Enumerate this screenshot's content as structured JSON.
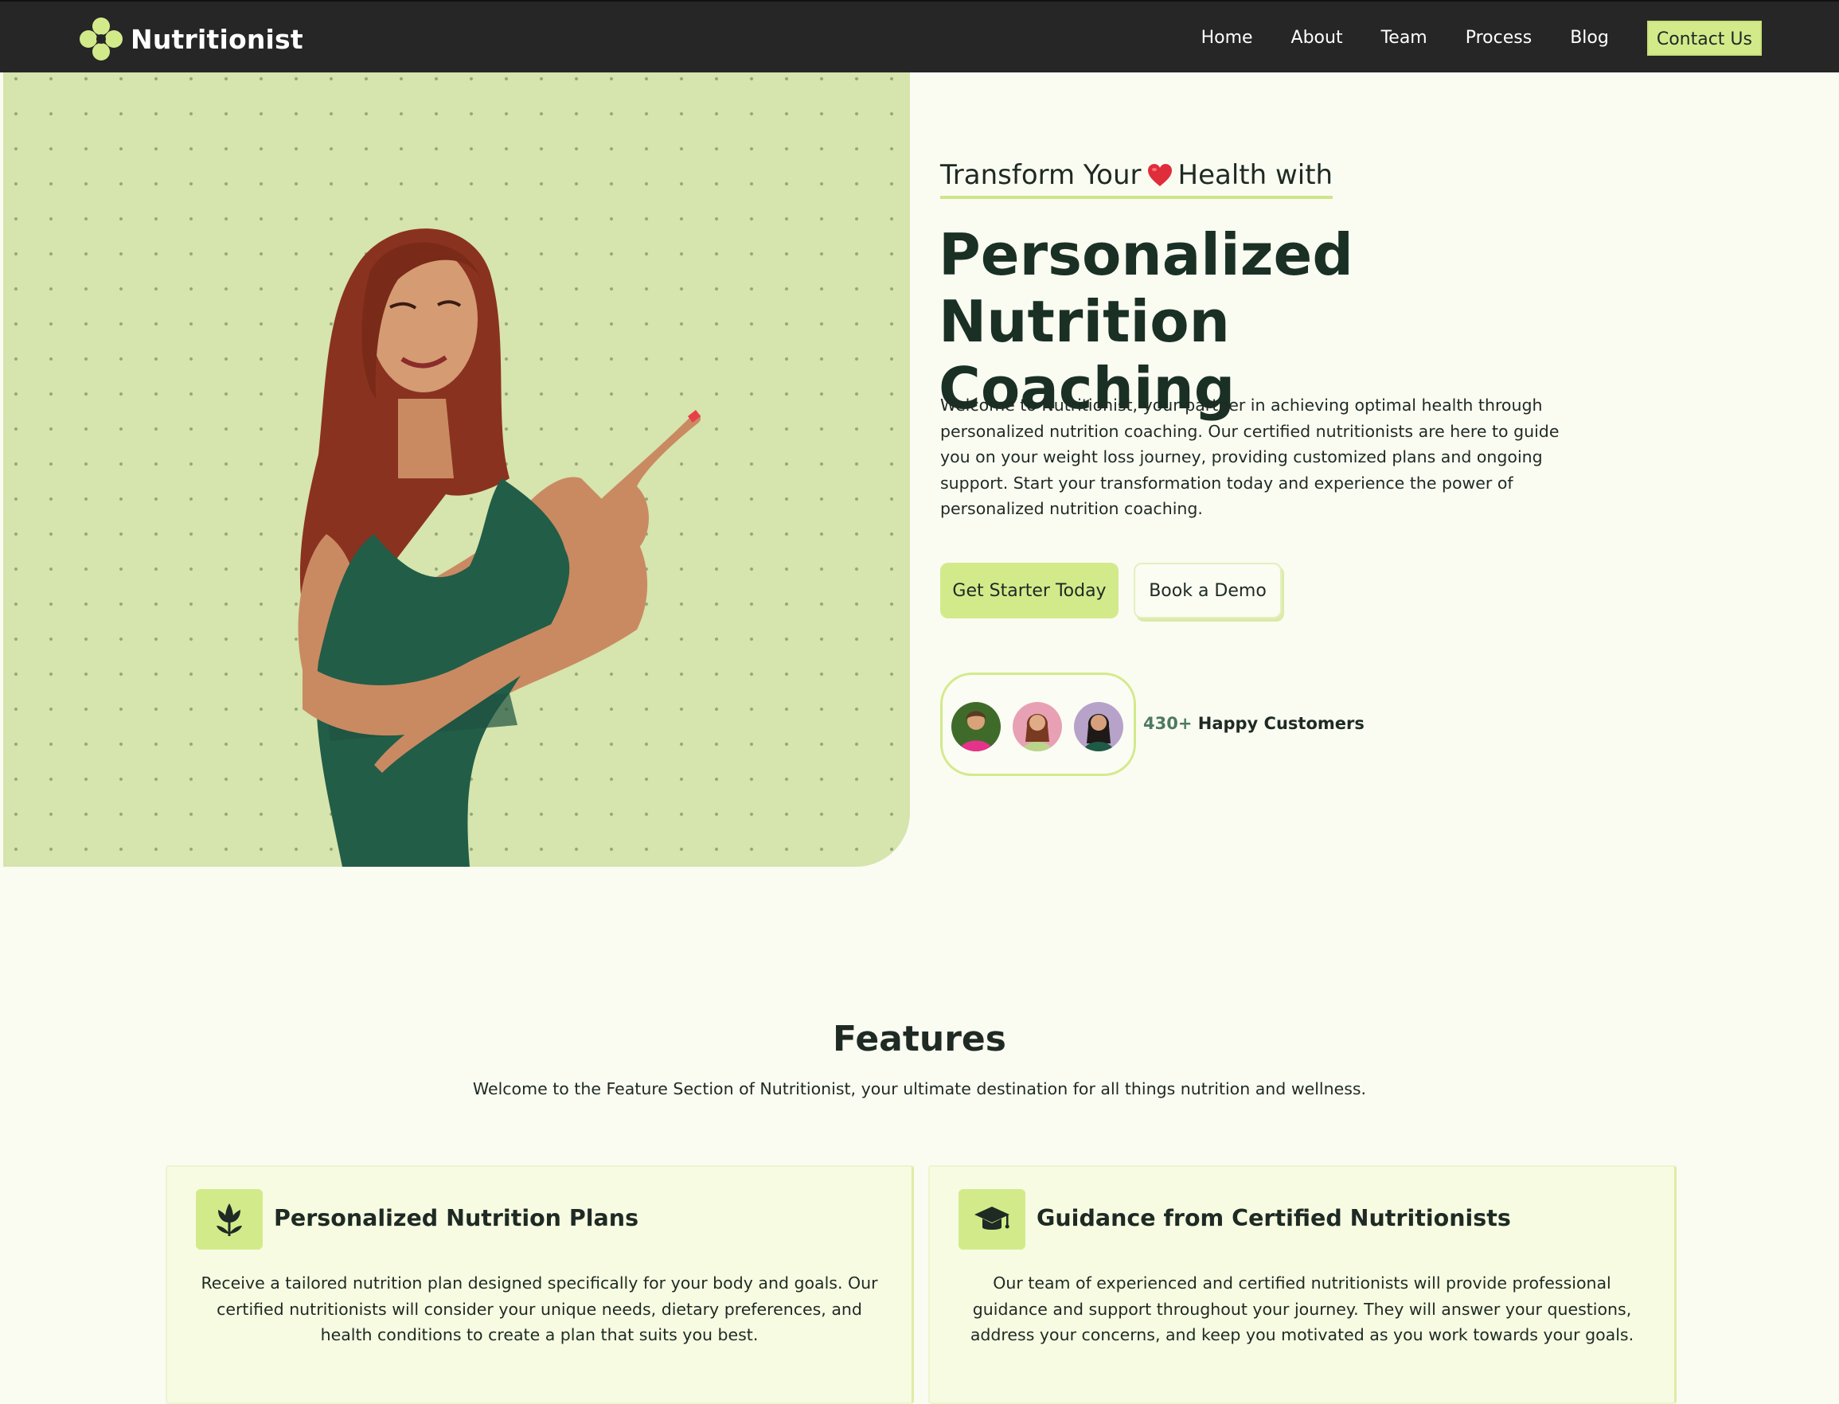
{
  "brand": {
    "name": "Nutritionist",
    "accent": "#d3ea8b",
    "dark": "#262626",
    "hero_bg": "#d6e4ad"
  },
  "nav": {
    "links": [
      "Home",
      "About",
      "Team",
      "Process",
      "Blog"
    ],
    "cta_label": "Contact Us"
  },
  "hero": {
    "eyebrow_before": "Transform Your",
    "eyebrow_icon": "heart-icon",
    "eyebrow_after": "Health with",
    "title_line1": "Personalized Nutrition",
    "title_line2": "Coaching",
    "description": "Welcome to Nutritionist, your partner in achieving optimal health through personalized nutrition coaching. Our certified nutritionists are here to guide you on your weight loss journey, providing customized plans and ongoing support. Start your transformation today and experience the power of personalized nutrition coaching.",
    "primary_button": "Get Starter Today",
    "secondary_button": "Book a Demo",
    "customers_count": "430+",
    "customers_label": "Happy Customers"
  },
  "features": {
    "title": "Features",
    "subtitle": "Welcome to the Feature Section of Nutritionist, your ultimate destination for all things nutrition and wellness.",
    "cards": [
      {
        "icon": "flower-icon",
        "title": "Personalized Nutrition Plans",
        "text": "Receive a tailored nutrition plan designed specifically for your body and goals. Our certified nutritionists will consider your unique needs, dietary preferences, and health conditions to create a plan that suits you best."
      },
      {
        "icon": "graduation-cap-icon",
        "title": "Guidance from Certified Nutritionists",
        "text": "Our team of experienced and certified nutritionists will provide professional guidance and support throughout your journey. They will answer your questions, address your concerns, and keep you motivated as you work towards your goals."
      }
    ]
  }
}
